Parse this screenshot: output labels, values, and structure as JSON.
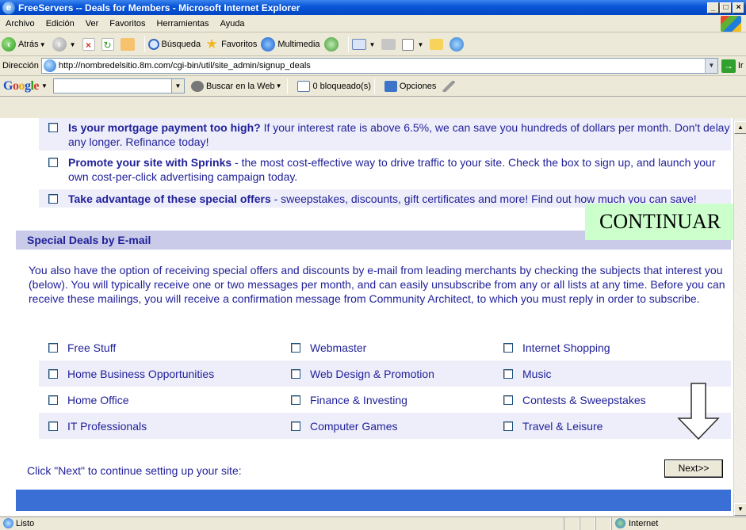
{
  "window": {
    "title": "FreeServers -- Deals for Members - Microsoft Internet Explorer",
    "controls": [
      "_",
      "□",
      "×"
    ]
  },
  "menu": [
    "Archivo",
    "Edición",
    "Ver",
    "Favoritos",
    "Herramientas",
    "Ayuda"
  ],
  "toolbar": {
    "back": "Atrás",
    "search": "Búsqueda",
    "favorites": "Favoritos",
    "media": "Multimedia"
  },
  "address": {
    "label": "Dirección",
    "url": "http://nombredelsitio.8m.com/cgi-bin/util/site_admin/signup_deals",
    "go": "Ir"
  },
  "google": {
    "logo": "Google",
    "search_web": "Buscar en la Web",
    "blocked": "0 bloqueado(s)",
    "options": "Opciones"
  },
  "offers": [
    {
      "bold": "Is your mortgage payment too high?",
      "text": " If your interest rate is above 6.5%, we can save you hundreds of dollars per month. Don't delay any longer. Refinance today!"
    },
    {
      "bold": "Promote your site with Sprinks",
      "text": " - the most cost-effective way to drive traffic to your site. Check the box to sign up, and launch your own cost-per-click advertising campaign today."
    },
    {
      "bold": "Take advantage of these special offers",
      "text": " - sweepstakes, discounts, gift certificates and more! Find out how much you can save!"
    }
  ],
  "deals": {
    "header": "Special Deals by E-mail",
    "intro": "You also have the option of receiving special offers and discounts by e-mail from leading merchants by checking the subjects that interest you (below). You will typically receive one or two messages per month, and can easily unsubscribe from any or all lists at any time. Before you can receive these mailings, you will receive a confirmation message from Community Architect, to which you must reply in order to subscribe.",
    "rows": [
      [
        "Free Stuff",
        "Webmaster",
        "Internet Shopping"
      ],
      [
        "Home Business Opportunities",
        "Web Design & Promotion",
        "Music"
      ],
      [
        "Home Office",
        "Finance & Investing",
        "Contests & Sweepstakes"
      ],
      [
        "IT Professionals",
        "Computer Games",
        "Travel & Leisure"
      ]
    ]
  },
  "next_prompt": "Click \"Next\" to continue setting up your site:",
  "next_button": "Next>>",
  "annotation": "CONTINUAR",
  "status": {
    "text": "Listo",
    "zone": "Internet"
  }
}
